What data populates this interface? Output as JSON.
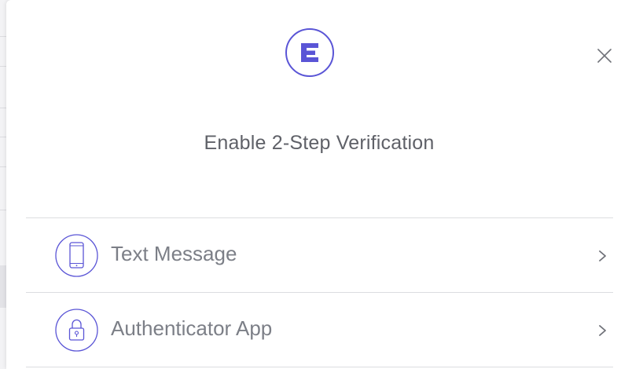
{
  "modal": {
    "title": "Enable 2-Step Verification",
    "brand_icon": "brand-e-logo-icon",
    "close_icon": "close-icon",
    "accent_color": "#5a55d6"
  },
  "options": [
    {
      "label": "Text Message",
      "icon": "smartphone-icon",
      "chevron": "chevron-right-icon"
    },
    {
      "label": "Authenticator App",
      "icon": "lock-icon",
      "chevron": "chevron-right-icon"
    }
  ]
}
